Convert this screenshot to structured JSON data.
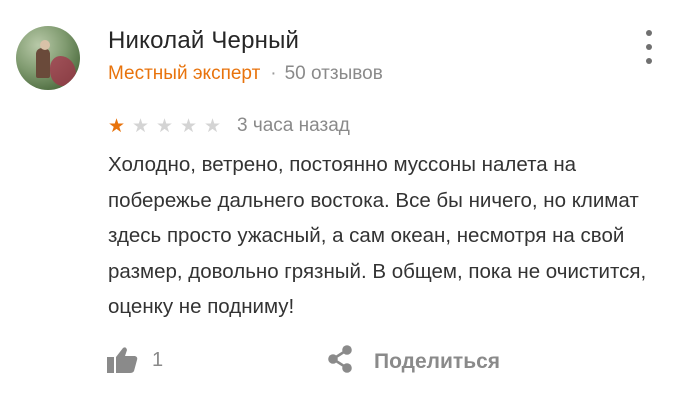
{
  "review": {
    "author_name": "Николай Черный",
    "author_badge": "Местный эксперт",
    "separator": "·",
    "review_count": "50 отзывов",
    "rating": 1,
    "rating_max": 5,
    "time_ago": "3 часа назад",
    "text": "Холодно, ветрено, постоянно муссоны налета на побережье дальнего востока. Все бы ничего, но климат здесь просто ужасный, а сам океан, несмотря на свой размер, довольно грязный. В общем, пока не очистится, оценку не подниму!",
    "likes": "1",
    "share_label": "Поделиться"
  },
  "icons": {
    "more": "more-vertical-icon",
    "like": "thumbs-up-icon",
    "share": "share-icon",
    "star": "star-icon"
  },
  "colors": {
    "accent": "#e8730c",
    "star_empty": "#d4d4d4",
    "muted_text": "#8a8a8a",
    "body_text": "#333333"
  }
}
